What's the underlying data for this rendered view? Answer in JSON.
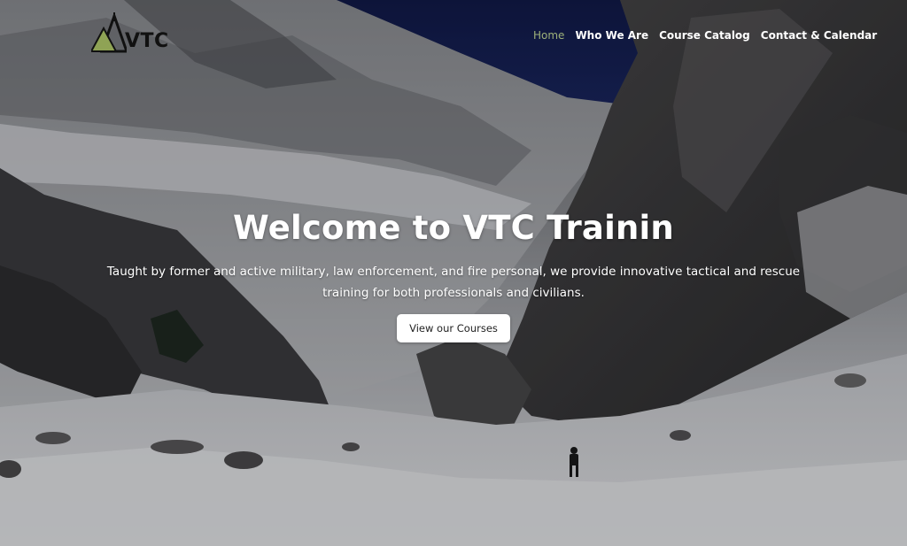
{
  "brand": {
    "name": "VTC",
    "accent": "#9eb17a",
    "logo_triangle_color": "#8fa355"
  },
  "nav": {
    "items": [
      {
        "label": "Home",
        "active": true
      },
      {
        "label": "Who We Are",
        "active": false
      },
      {
        "label": "Course Catalog",
        "active": false
      },
      {
        "label": "Contact & Calendar",
        "active": false
      }
    ]
  },
  "hero": {
    "title": "Welcome to VTC Trainin",
    "subtitle": "Taught by former and active military, law enforcement, and fire personal, we provide innovative tactical and rescue training for both professionals and civilians.",
    "cta_label": "View our Courses",
    "background": "snowy-mountain-canyon-with-climber"
  }
}
